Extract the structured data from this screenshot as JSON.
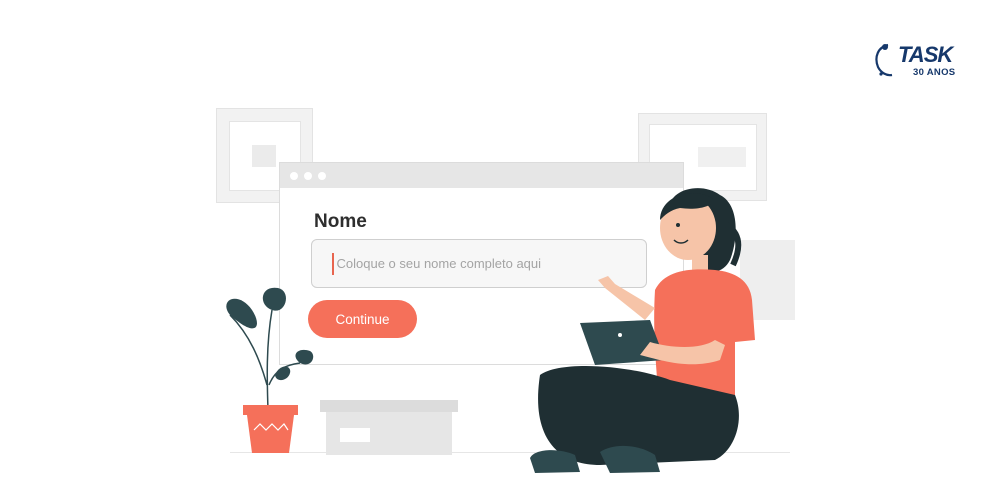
{
  "form": {
    "label": "Nome",
    "name_input": {
      "value": "",
      "placeholder": "Coloque o seu nome completo aqui"
    },
    "continue_label": "Continue"
  },
  "logo": {
    "name": "TASK",
    "tagline": "30 ANOS"
  },
  "colors": {
    "accent": "#f5705a",
    "brand": "#16386b",
    "window_bar": "#e6e6e6",
    "plant_leaf": "#2e4a4f"
  },
  "icons": [
    "task-logo-icon",
    "plant-illustration",
    "storage-box-illustration",
    "woman-with-tablet-illustration"
  ]
}
